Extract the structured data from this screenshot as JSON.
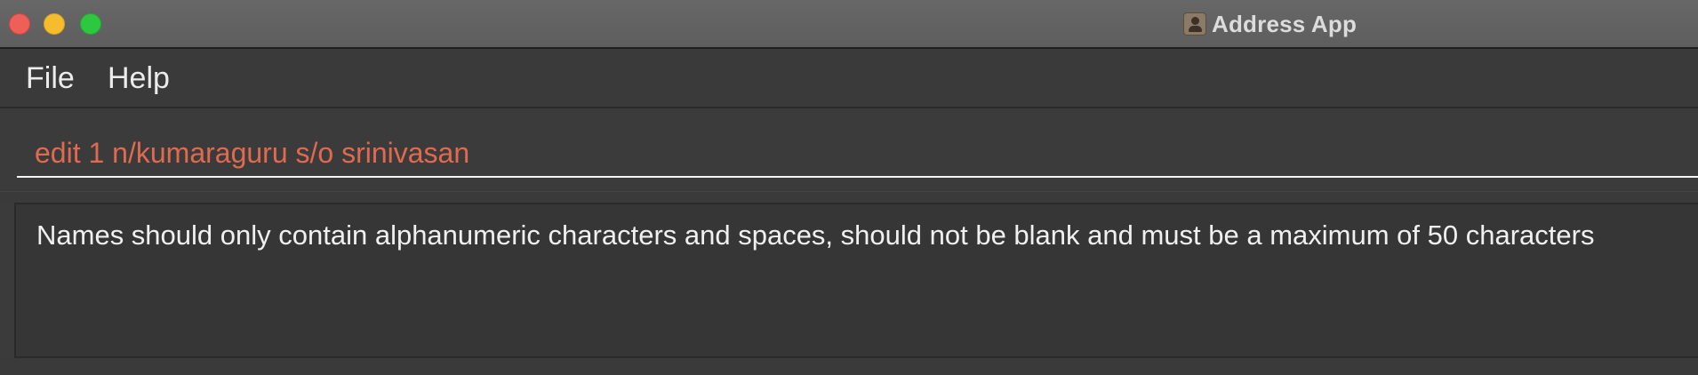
{
  "window": {
    "title": "Address App",
    "title_icon": "address-book-person-icon"
  },
  "menu": {
    "file_label": "File",
    "help_label": "Help"
  },
  "command_box": {
    "value": "edit 1 n/kumaraguru s/o srinivasan",
    "text_color": "#e06a50"
  },
  "result_display": {
    "message": "Names should only contain alphanumeric characters and spaces, should not be blank and must be a maximum of 50 characters"
  },
  "colors": {
    "close": "#ee5f57",
    "minimize": "#f5bd2e",
    "maximize": "#2ec840",
    "background": "#3b3b3b"
  }
}
